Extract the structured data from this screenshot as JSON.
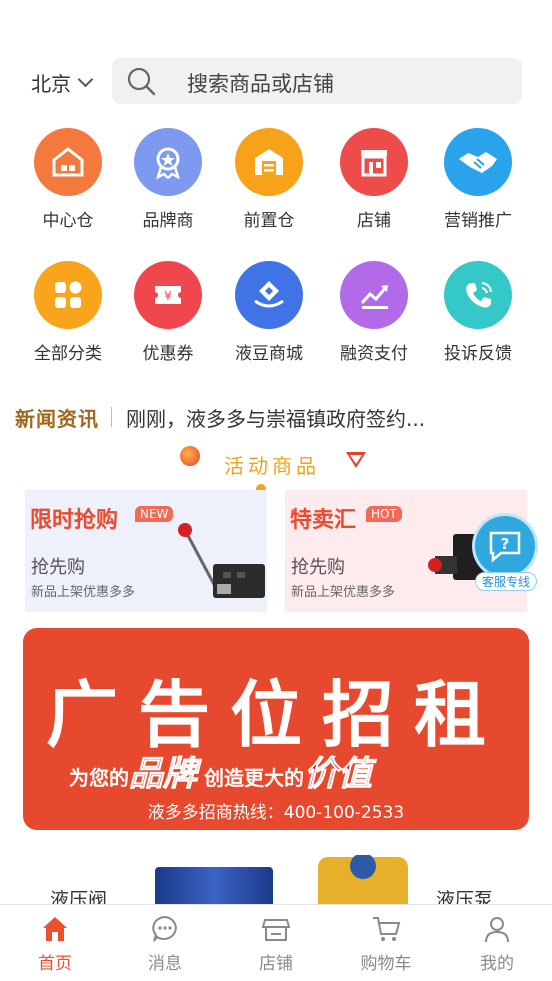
{
  "header": {
    "city": "北京",
    "search_placeholder": "搜索商品或店铺"
  },
  "categories": [
    {
      "label": "中心仓",
      "icon": "warehouse-icon",
      "color": "#f37a3c"
    },
    {
      "label": "品牌商",
      "icon": "award-icon",
      "color": "#7e9af0"
    },
    {
      "label": "前置仓",
      "icon": "storage-icon",
      "color": "#f8a21a"
    },
    {
      "label": "店铺",
      "icon": "store-icon",
      "color": "#ee4b4b"
    },
    {
      "label": "营销推广",
      "icon": "handshake-icon",
      "color": "#2aa3ec"
    },
    {
      "label": "全部分类",
      "icon": "grid-icon",
      "color": "#f9a51c"
    },
    {
      "label": "优惠券",
      "icon": "coupon-icon",
      "color": "#f0474f"
    },
    {
      "label": "液豆商城",
      "icon": "mall-icon",
      "color": "#3f73e6"
    },
    {
      "label": "融资支付",
      "icon": "finance-chart-icon",
      "color": "#b26ae9"
    },
    {
      "label": "投诉反馈",
      "icon": "phone-icon",
      "color": "#35c8c8"
    }
  ],
  "news": {
    "tag": "新闻资讯",
    "headline": "刚刚，液多多与崇福镇政府签约..."
  },
  "section": {
    "title": "活动商品"
  },
  "promos": [
    {
      "title": "限时抢购",
      "badge": "NEW",
      "subtitle": "抢先购",
      "desc": "新品上架优惠多多"
    },
    {
      "title": "特卖汇",
      "badge": "HOT",
      "subtitle": "抢先购",
      "desc": "新品上架优惠多多"
    }
  ],
  "service": {
    "label": "客服专线"
  },
  "ad": {
    "headline": "广告位招租",
    "line_prefix": "为您的",
    "line_highlight1": "品牌",
    "line_middle": " 创造更大的",
    "line_highlight2": "价值",
    "hotline": "液多多招商热线：400-100-2533"
  },
  "products": [
    {
      "label": "液压阀"
    },
    {
      "label": "液压泵"
    }
  ],
  "tabs": [
    {
      "label": "首页",
      "icon": "home-icon",
      "active": true
    },
    {
      "label": "消息",
      "icon": "message-icon",
      "active": false
    },
    {
      "label": "店铺",
      "icon": "store-icon",
      "active": false
    },
    {
      "label": "购物车",
      "icon": "cart-icon",
      "active": false
    },
    {
      "label": "我的",
      "icon": "user-icon",
      "active": false
    }
  ],
  "colors": {
    "accent": "#e8532f",
    "news_tag": "#a0671d",
    "section_title": "#f0a21a",
    "ad_bg": "#e6492d"
  }
}
